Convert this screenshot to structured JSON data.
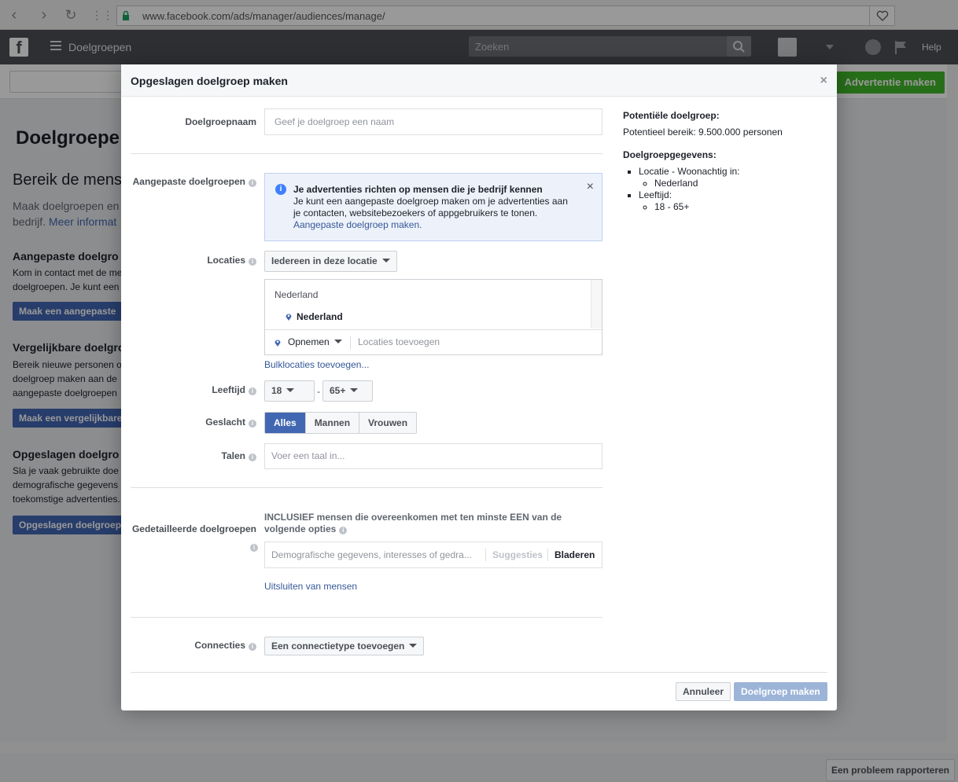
{
  "browser": {
    "url": "www.facebook.com/ads/manager/audiences/manage/"
  },
  "fb_header": {
    "section": "Doelgroepen",
    "search_placeholder": "Zoeken",
    "help": "Help"
  },
  "background": {
    "create_ad": "Advertentie maken",
    "title": "Doelgroepe",
    "reach_heading": "Bereik de mens",
    "intro_line1": "Maak doelgroepen en",
    "intro_line2": "bedrijf.",
    "intro_link": "Meer informat",
    "custom": {
      "heading": "Aangepaste doelgro",
      "line1": "Kom in contact met de me",
      "line2": "doelgroepen. Je kunt een",
      "button": "Maak een aangepaste"
    },
    "lookalike": {
      "heading": "Vergelijkbare doelgro",
      "line1": "Bereik nieuwe personen o",
      "line2": "doelgroep maken aan de",
      "line3": "aangepaste doelgroepen",
      "button": "Maak een vergelijkbare"
    },
    "saved": {
      "heading": "Opgeslagen doelgro",
      "line1": "Sla je vaak gebruikte doe",
      "line2": "demografische gegevens",
      "line3": "toekomstige advertenties.",
      "button": "Opgeslagen doelgroep"
    },
    "report": "Een probleem rapporteren"
  },
  "dialog": {
    "title": "Opgeslagen doelgroep maken",
    "name_label": "Doelgroepnaam",
    "name_placeholder": "Geef je doelgroep een naam",
    "custom_label": "Aangepaste doelgroepen",
    "notice": {
      "title": "Je advertenties richten op mensen die je bedrijf kennen",
      "body": "Je kunt een aangepaste doelgroep maken om je advertenties aan je contacten, websitebezoekers of appgebruikers te tonen.",
      "link": "Aangepaste doelgroep maken."
    },
    "locations_label": "Locaties",
    "locations_select": "Iedereen in deze locatie",
    "location_country": "Nederland",
    "location_item": "Nederland",
    "include_select": "Opnemen",
    "locations_placeholder": "Locaties toevoegen",
    "bulk_link": "Bulklocaties toevoegen...",
    "age_label": "Leeftijd",
    "age_min": "18",
    "age_sep": "-",
    "age_max": "65+",
    "gender_label": "Geslacht",
    "gender_options": [
      "Alles",
      "Mannen",
      "Vrouwen"
    ],
    "gender_selected": "Alles",
    "languages_label": "Talen",
    "languages_placeholder": "Voer een taal in...",
    "detailed_label": "Gedetailleerde doelgroepen",
    "detailed_include": "INCLUSIEF mensen die overeenkomen met ten minste EEN van de volgende opties",
    "detailed_placeholder": "Demografische gegevens, interesses of gedra...",
    "suggestions": "Suggesties",
    "browse": "Bladeren",
    "exclude_link": "Uitsluiten van mensen",
    "connections_label": "Connecties",
    "connections_select": "Een connectietype toevoegen",
    "cancel": "Annuleer",
    "create": "Doelgroep maken"
  },
  "summary": {
    "potential_heading": "Potentiële doelgroep:",
    "potential_reach": "Potentieel bereik: 9.500.000 personen",
    "details_heading": "Doelgroepgegevens:",
    "location_label": "Locatie - Woonachtig in:",
    "location_value": "Nederland",
    "age_label": "Leeftijd:",
    "age_value": "18 - 65+"
  },
  "colors": {
    "fb_header": "#4b4f56",
    "primary": "#4267b2",
    "green": "#42b72a",
    "link": "#365899"
  }
}
